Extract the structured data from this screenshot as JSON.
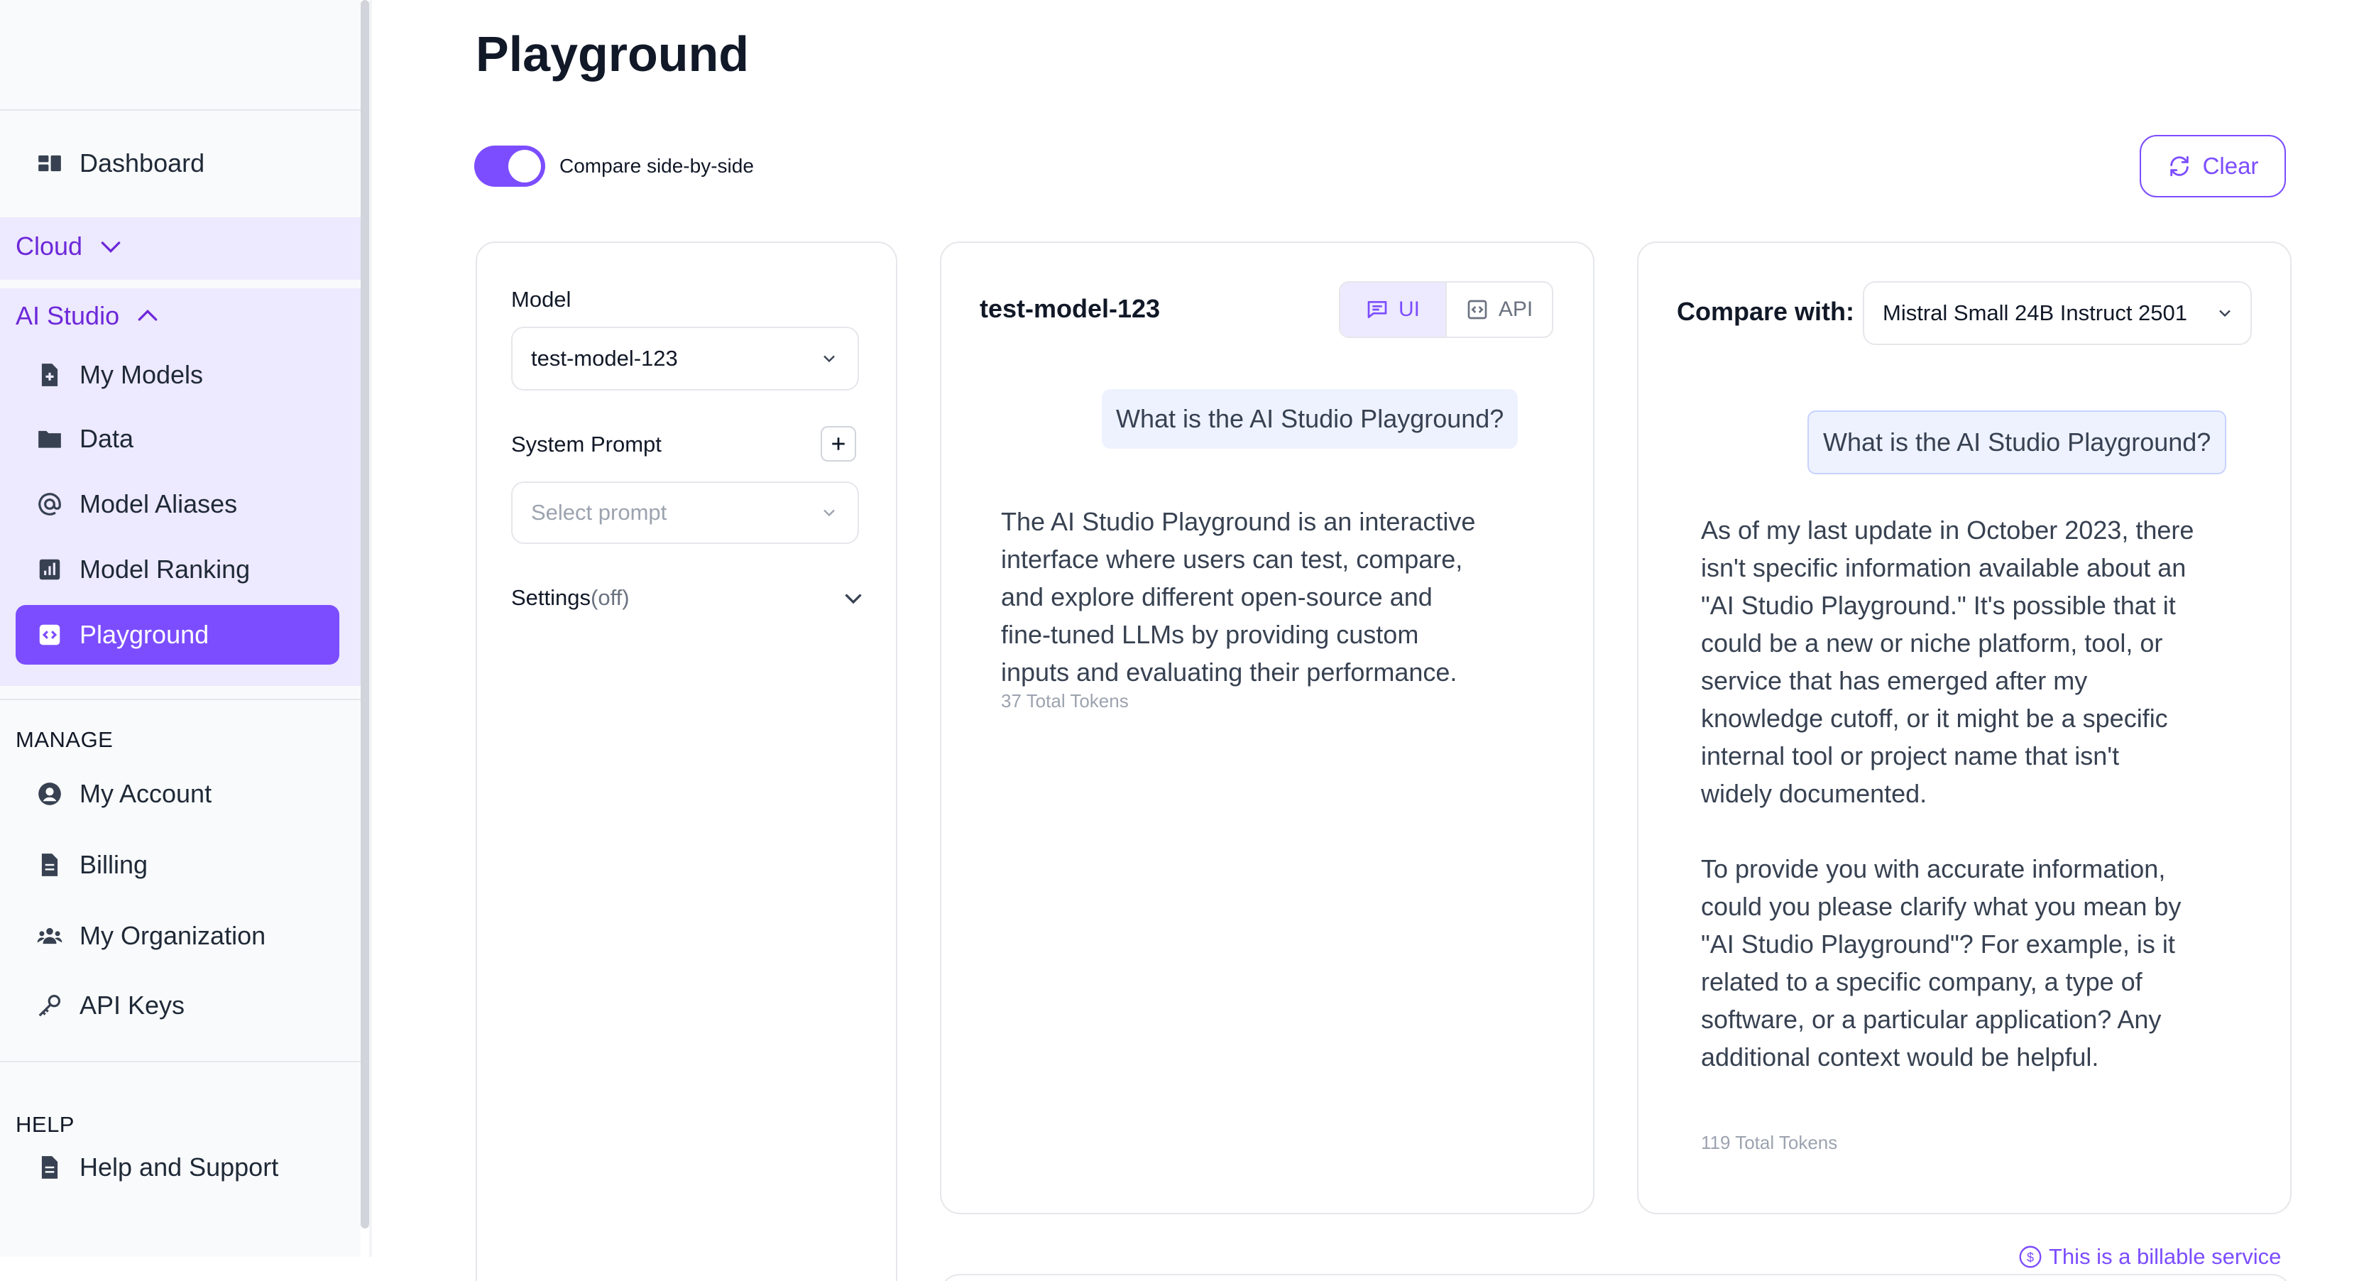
{
  "sidebar": {
    "dashboard_label": "Dashboard",
    "cloud_label": "Cloud",
    "ai_studio_label": "AI Studio",
    "ai_studio_items": [
      {
        "label": "My Models",
        "icon": "file-plus-icon"
      },
      {
        "label": "Data",
        "icon": "folder-icon"
      },
      {
        "label": "Model Aliases",
        "icon": "at-sign-icon"
      },
      {
        "label": "Model Ranking",
        "icon": "bar-chart-icon"
      },
      {
        "label": "Playground",
        "icon": "code-square-icon",
        "active": true
      }
    ],
    "manage_label": "MANAGE",
    "manage_items": [
      {
        "label": "My Account",
        "icon": "user-circle-icon"
      },
      {
        "label": "Billing",
        "icon": "document-icon"
      },
      {
        "label": "My Organization",
        "icon": "users-icon"
      },
      {
        "label": "API Keys",
        "icon": "key-icon"
      }
    ],
    "help_label": "HELP",
    "help_items": [
      {
        "label": "Help and Support",
        "icon": "document-icon"
      }
    ]
  },
  "page": {
    "title": "Playground",
    "compare_toggle_label": "Compare side-by-side",
    "compare_toggle_on": true,
    "clear_label": "Clear",
    "billable_label": "This is a billable service"
  },
  "settings_panel": {
    "model_label": "Model",
    "model_value": "test-model-123",
    "system_prompt_label": "System Prompt",
    "system_prompt_placeholder": "Select prompt",
    "settings_label": "Settings",
    "settings_state": "(off)"
  },
  "model_panel": {
    "title": "test-model-123",
    "tab_ui_label": "UI",
    "tab_api_label": "API",
    "user_message": "What is the AI Studio Playground?",
    "response": "The AI Studio Playground is an interactive\ninterface where users can test, compare,\nand explore different open-source and\nfine-tuned LLMs by providing custom\ninputs and evaluating their performance.",
    "tokens": "37 Total Tokens"
  },
  "compare_panel": {
    "label": "Compare with:",
    "model_value": "Mistral Small 24B Instruct 2501",
    "user_message": "What is the AI Studio Playground?",
    "response": "As of my last update in October 2023, there\nisn't specific information available about an\n\"AI Studio Playground.\" It's possible that it\ncould be a new or niche platform, tool, or\nservice that has emerged after my\nknowledge cutoff, or it might be a specific\ninternal tool or project name that isn't\nwidely documented.\n\nTo provide you with accurate information,\ncould you please clarify what you mean by\n\"AI Studio Playground\"? For example, is it\nrelated to a specific company, a type of\nsoftware, or a particular application? Any\nadditional context would be helpful.",
    "tokens": "119 Total Tokens"
  },
  "colors": {
    "accent": "#7c4dff",
    "accent_light": "#ede9fe",
    "bubble_bg": "#eef2ff"
  }
}
